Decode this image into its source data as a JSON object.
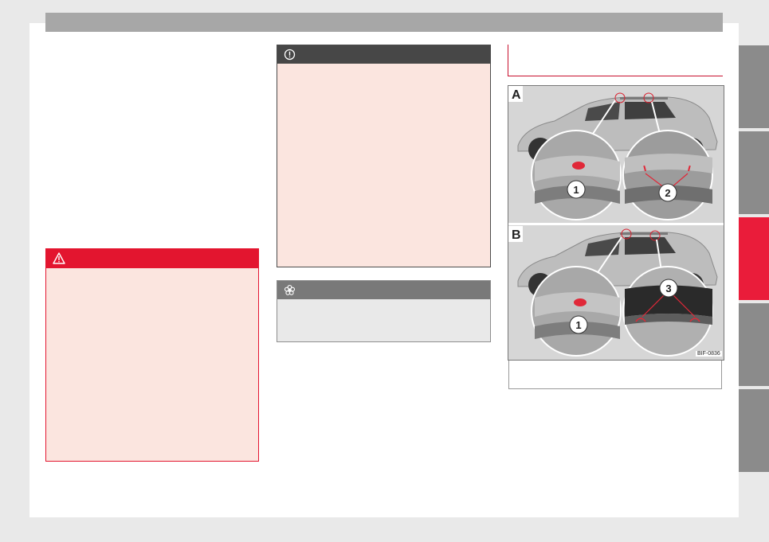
{
  "figure": {
    "panel_a_label": "A",
    "panel_b_label": "B",
    "callouts": [
      "1",
      "2",
      "1",
      "3"
    ],
    "image_code": "BIF-0836"
  },
  "icons": {
    "warning": "warning-triangle-icon",
    "notice": "exclamation-circle-icon",
    "environment": "flower-icon"
  },
  "colors": {
    "accent": "#e3152f",
    "notice_header": "#474747",
    "env_header": "#797979",
    "tab_inactive": "#8b8b8b",
    "tab_active": "#ea1c3a"
  }
}
